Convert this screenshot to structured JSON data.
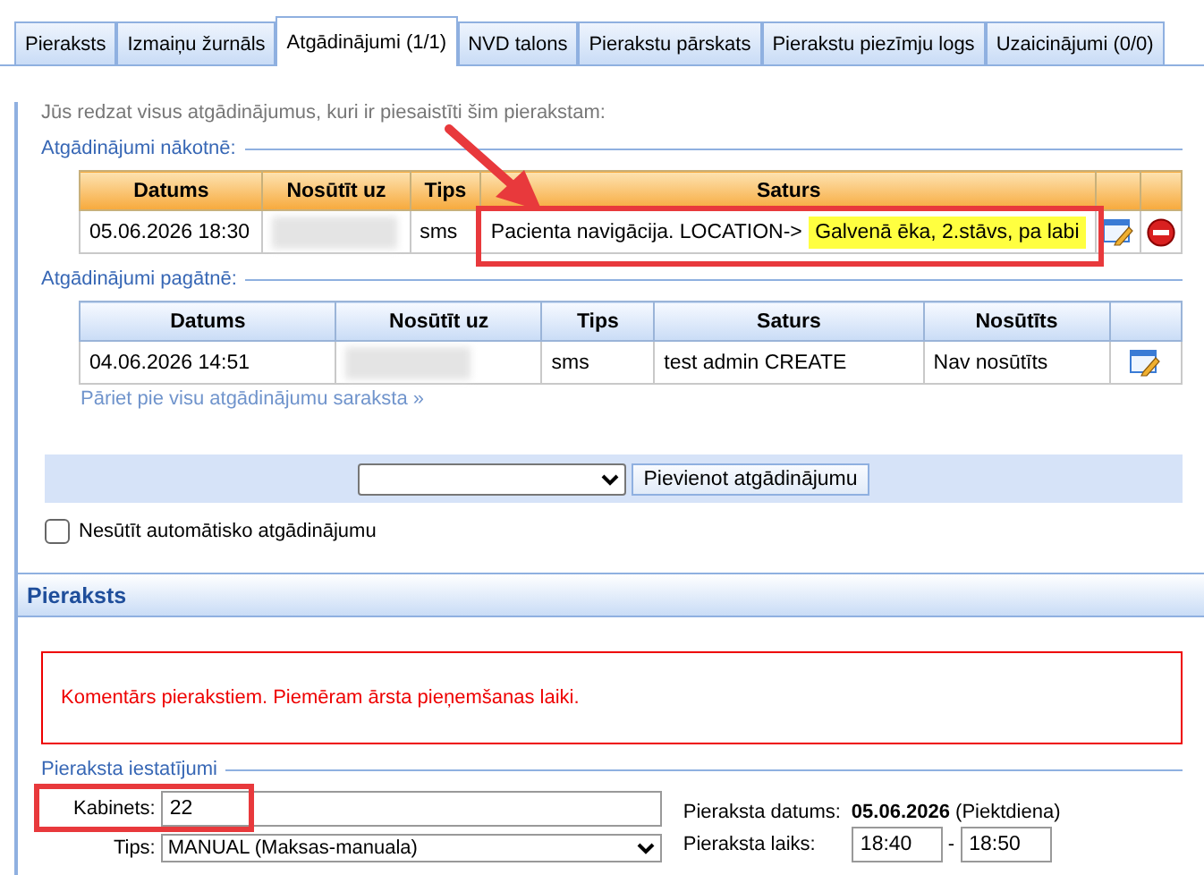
{
  "tabs": [
    {
      "label": "Pieraksts",
      "selected": false
    },
    {
      "label": "Izmaiņu žurnāls",
      "selected": false
    },
    {
      "label": "Atgādinājumi (1/1)",
      "selected": true
    },
    {
      "label": "NVD talons",
      "selected": false
    },
    {
      "label": "Pierakstu pārskats",
      "selected": false
    },
    {
      "label": "Pierakstu piezīmju logs",
      "selected": false
    },
    {
      "label": "Uzaicinājumi (0/0)",
      "selected": false
    }
  ],
  "intro": "Jūs redzat visus atgādinājumus, kuri ir piesaistīti šim pierakstam:",
  "future": {
    "title": "Atgādinājumi nākotnē:",
    "columns": [
      "Datums",
      "Nosūtīt uz",
      "Tips",
      "Saturs"
    ],
    "rows": [
      {
        "date": "05.06.2026 18:30",
        "type": "sms",
        "content": "Pacienta navigācija. LOCATION->",
        "highlight": "Galvenā ēka, 2.stāvs, pa labi"
      }
    ]
  },
  "past": {
    "title": "Atgādinājumi pagātnē:",
    "columns": [
      "Datums",
      "Nosūtīt uz",
      "Tips",
      "Saturs",
      "Nosūtīts"
    ],
    "rows": [
      {
        "date": "04.06.2026 14:51",
        "type": "sms",
        "content": "test admin CREATE",
        "status": "Nav nosūtīts"
      }
    ]
  },
  "all_link": "Pāriet pie visu atgādinājumu saraksta »",
  "add_button": "Pievienot atgādinājumu",
  "no_auto": {
    "label": "Nesūtīt automātisko atgādinājumu",
    "checked": false
  },
  "section_title": "Pieraksts",
  "comment": "Komentārs pierakstiem. Piemēram ārsta pieņemšanas laiki.",
  "settings": {
    "title": "Pieraksta iestatījumi",
    "room_label": "Kabinets:",
    "room_value": "22",
    "type_label": "Tips:",
    "type_value": "MANUAL (Maksas-manuala)",
    "date_label": "Pieraksta datums:",
    "date_value": "05.06.2026",
    "day": "(Piektdiena)",
    "time_label": "Pieraksta laiks:",
    "time_from": "18:40",
    "time_sep": "-",
    "time_to": "18:50"
  }
}
